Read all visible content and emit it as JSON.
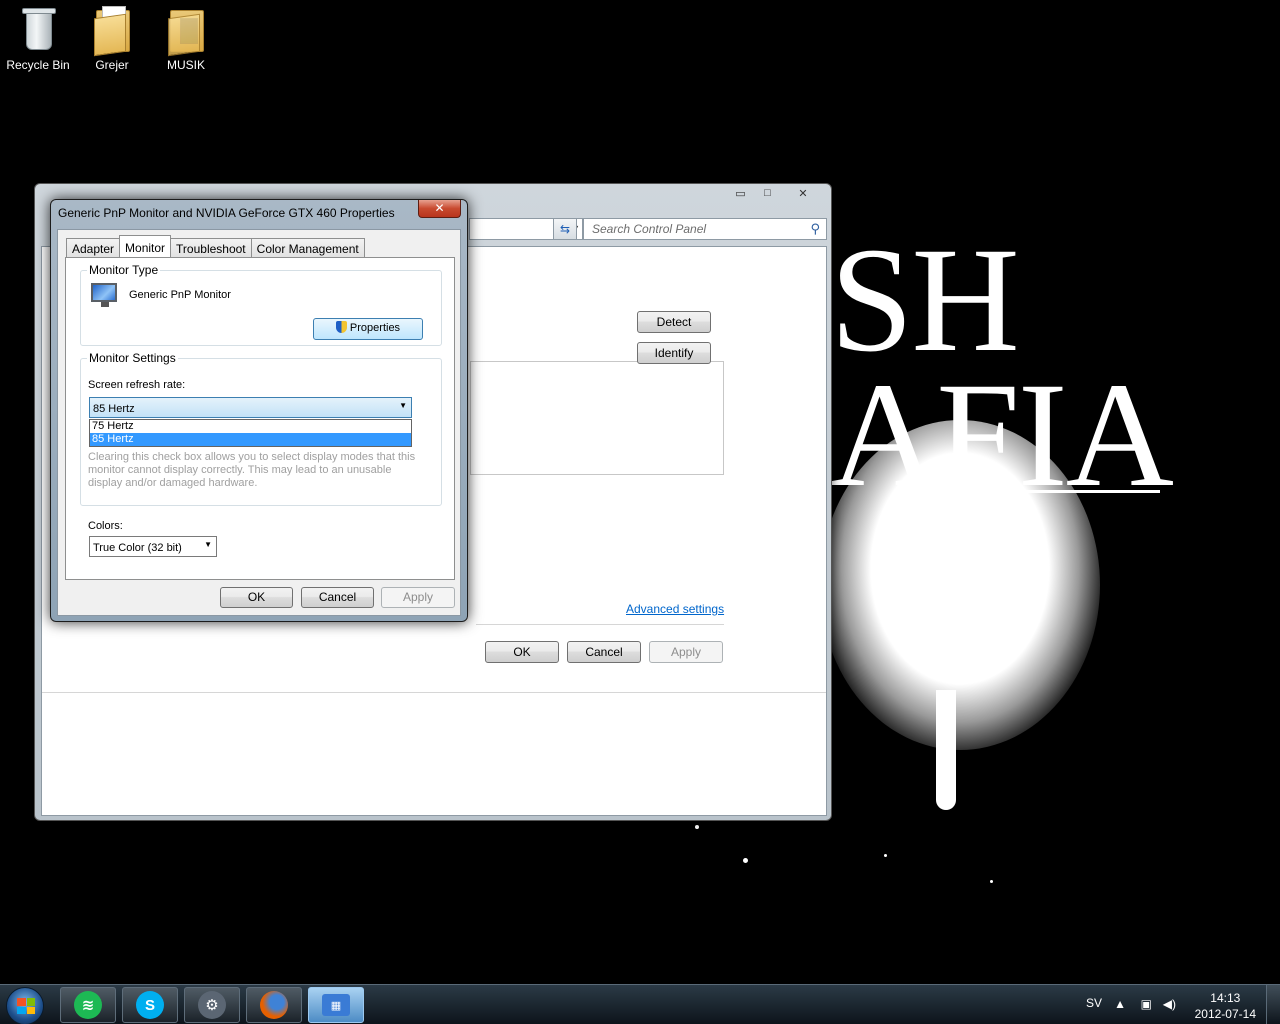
{
  "desktop": {
    "background_text": {
      "line1": "SH",
      "line2": "AFIA"
    },
    "icons": [
      {
        "label": "Recycle Bin",
        "icon": "recycle-bin-icon"
      },
      {
        "label": "Grejer",
        "icon": "folder-icon"
      },
      {
        "label": "MUSIK",
        "icon": "folder-icon"
      }
    ]
  },
  "control_panel": {
    "caption_buttons": {
      "minimize": "▭",
      "maximize": "□",
      "close": "✕"
    },
    "search_placeholder": "Search Control Panel",
    "detect_label": "Detect",
    "identify_label": "Identify",
    "advanced_link": "Advanced settings",
    "ok_label": "OK",
    "cancel_label": "Cancel",
    "apply_label": "Apply"
  },
  "dialog": {
    "title": "Generic PnP Monitor and NVIDIA GeForce GTX 460 Properties",
    "close_glyph": "✕",
    "tabs": [
      "Adapter",
      "Monitor",
      "Troubleshoot",
      "Color Management"
    ],
    "active_tab": "Monitor",
    "monitor_type": {
      "group_label": "Monitor Type",
      "monitor_name": "Generic PnP Monitor",
      "properties_label": "Properties"
    },
    "monitor_settings": {
      "group_label": "Monitor Settings",
      "refresh_label": "Screen refresh rate:",
      "refresh_value": "85 Hertz",
      "refresh_options": [
        "75 Hertz",
        "85 Hertz"
      ],
      "selected_option": "85 Hertz",
      "warning_text": "Clearing this check box allows you to select display modes that this monitor cannot display correctly. This may lead to an unusable display and/or damaged hardware."
    },
    "colors": {
      "label": "Colors:",
      "value": "True Color (32 bit)"
    },
    "ok_label": "OK",
    "cancel_label": "Cancel",
    "apply_label": "Apply"
  },
  "taskbar": {
    "pinned": [
      {
        "name": "spotify",
        "icon": "spotify-icon",
        "color": "#1db954"
      },
      {
        "name": "skype",
        "icon": "skype-icon",
        "color": "#00aff0"
      },
      {
        "name": "steam",
        "icon": "steam-icon",
        "color": "#5b6673"
      },
      {
        "name": "firefox",
        "icon": "firefox-icon",
        "color": "#e66000"
      },
      {
        "name": "control-panel",
        "icon": "control-panel-icon",
        "color": "#3a7bd5"
      }
    ],
    "language": "SV",
    "time": "14:13",
    "date": "2012-07-14"
  }
}
